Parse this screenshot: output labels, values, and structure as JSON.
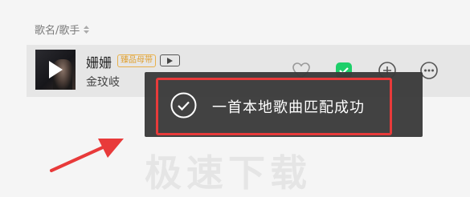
{
  "list_header": {
    "column_label": "歌名/歌手"
  },
  "song": {
    "title": "姗姗",
    "quality_badge": "臻品母带",
    "artist": "金玟岐"
  },
  "toast": {
    "message": "一首本地歌曲匹配成功"
  },
  "watermark": {
    "text": "极速下载"
  },
  "icons": {
    "sort": "sort-icon",
    "play": "play-icon",
    "mv": "mv-icon",
    "like": "heart-icon",
    "downloaded": "download-check-icon",
    "add": "add-icon",
    "more": "more-icon",
    "success": "check-circle-icon"
  },
  "colors": {
    "downloaded_green": "#1ecf6a",
    "toast_bg": "#3a3a3a",
    "highlight_red": "#e83a3a",
    "badge_gold": "#e0a030"
  }
}
